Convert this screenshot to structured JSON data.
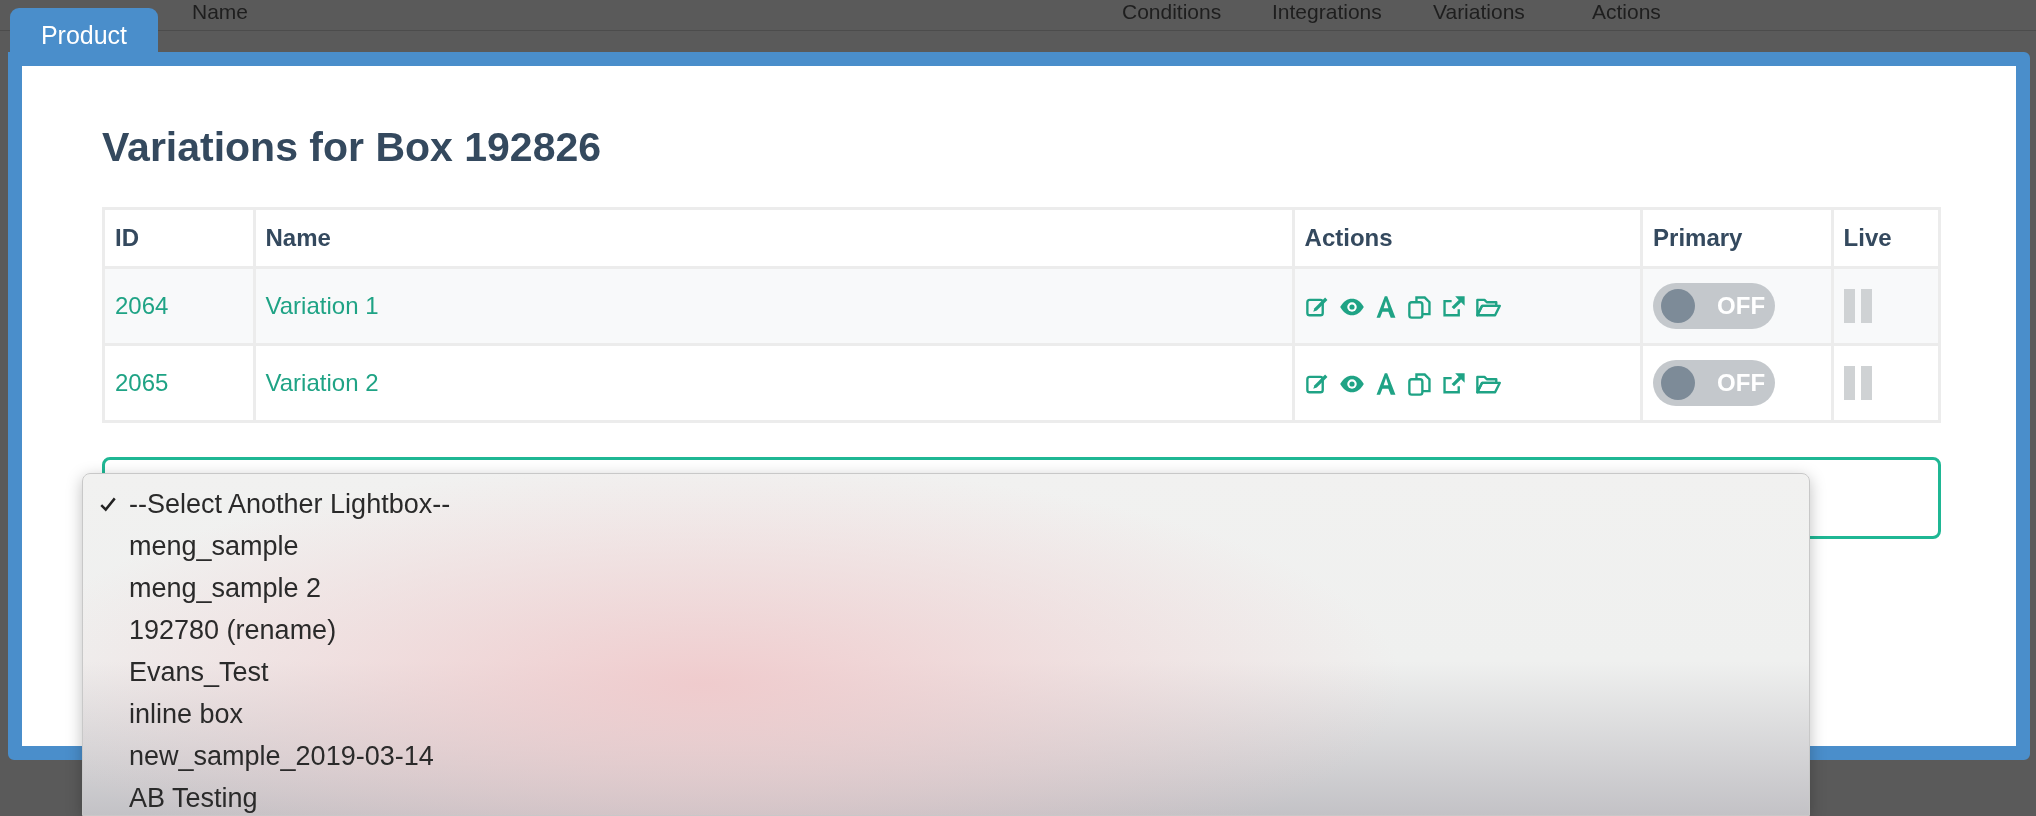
{
  "background_table": {
    "columns": [
      "Name",
      "Conditions",
      "Integrations",
      "Variations",
      "Actions"
    ]
  },
  "modal": {
    "tab": "Product",
    "title": "Variations for Box 192826",
    "table": {
      "columns": [
        "ID",
        "Name",
        "Actions",
        "Primary",
        "Live"
      ],
      "rows": [
        {
          "id": "2064",
          "name": "Variation 1",
          "primary": {
            "on": false,
            "label": "OFF"
          }
        },
        {
          "id": "2065",
          "name": "Variation 2",
          "primary": {
            "on": false,
            "label": "OFF"
          }
        }
      ]
    },
    "select": {
      "options": [
        {
          "label": "--Select Another Lightbox--",
          "selected": true
        },
        {
          "label": "meng_sample",
          "selected": false
        },
        {
          "label": "meng_sample 2",
          "selected": false
        },
        {
          "label": "192780 (rename)",
          "selected": false
        },
        {
          "label": "Evans_Test",
          "selected": false
        },
        {
          "label": "inline box",
          "selected": false
        },
        {
          "label": "new_sample_2019-03-14",
          "selected": false
        },
        {
          "label": "AB Testing",
          "selected": false
        }
      ]
    }
  }
}
